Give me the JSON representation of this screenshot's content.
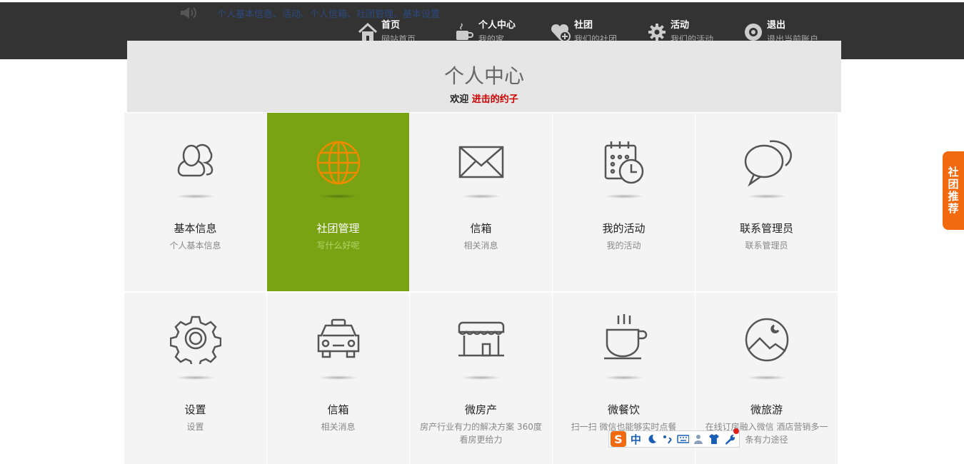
{
  "marquee": {
    "text": "个人基本信息、活动、个人信箱、社团管理、基本设置"
  },
  "nav": [
    {
      "title": "首页",
      "sub": "网站首页",
      "icon": "home-icon"
    },
    {
      "title": "个人中心",
      "sub": "我的家",
      "icon": "coffee-icon"
    },
    {
      "title": "社团",
      "sub": "我们的社团",
      "icon": "heart-plus-icon"
    },
    {
      "title": "活动",
      "sub": "我们的活动",
      "icon": "gear-icon"
    },
    {
      "title": "退出",
      "sub": "退出当前账户",
      "icon": "disc-icon"
    }
  ],
  "header": {
    "title": "个人中心",
    "welcome": "欢迎",
    "username": "进击的约子"
  },
  "tiles": [
    {
      "name": "基本信息",
      "desc": "个人基本信息",
      "icon": "users-icon"
    },
    {
      "name": "社团管理",
      "desc": "写什么好呢",
      "icon": "globe-icon"
    },
    {
      "name": "信箱",
      "desc": "相关消息",
      "icon": "envelope-icon"
    },
    {
      "name": "我的活动",
      "desc": "我的活动",
      "icon": "calendar-clock-icon"
    },
    {
      "name": "联系管理员",
      "desc": "联系管理员",
      "icon": "chat-bubbles-icon"
    },
    {
      "name": "设置",
      "desc": "设置",
      "icon": "settings-gear-icon"
    },
    {
      "name": "信箱",
      "desc": "相关消息",
      "icon": "taxi-icon"
    },
    {
      "name": "微房产",
      "desc": "房产行业有力的解决方案 360度看房更给力",
      "icon": "storefront-icon"
    },
    {
      "name": "微餐饮",
      "desc": "扫一扫 微信也能够实时点餐",
      "icon": "coffee-cup-icon"
    },
    {
      "name": "微旅游",
      "desc": "在线订房融入微信 酒店营销多一条有力途径",
      "icon": "landscape-icon"
    }
  ],
  "sidetab": {
    "label": "社团推荐"
  },
  "ime": {
    "logo": "S",
    "mode": "中"
  },
  "colors": {
    "active_tile": "#7aa314",
    "accent": "#f26a10",
    "username": "#cc0000"
  }
}
